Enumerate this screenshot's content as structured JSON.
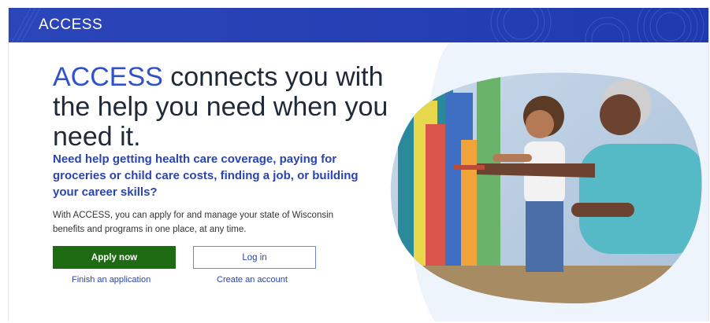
{
  "header": {
    "brand": "ACCESS"
  },
  "hero": {
    "headline_accent": "ACCESS",
    "headline_rest": " connects you with the help you need when you need it.",
    "subhead": "Need help getting health care coverage, paying for groceries or child care costs, finding a job, or building your career skills?",
    "description": "With ACCESS, you can apply for and manage your state of Wisconsin benefits and programs in one place, at any time."
  },
  "actions": {
    "apply_label": "Apply now",
    "login_label": "Log in",
    "finish_link": "Finish an application",
    "create_link": "Create an account"
  },
  "colors": {
    "header_blue": "#2540b4",
    "accent_blue": "#2f52c8",
    "apply_green": "#1e6b13",
    "link_blue": "#2a44b1"
  }
}
